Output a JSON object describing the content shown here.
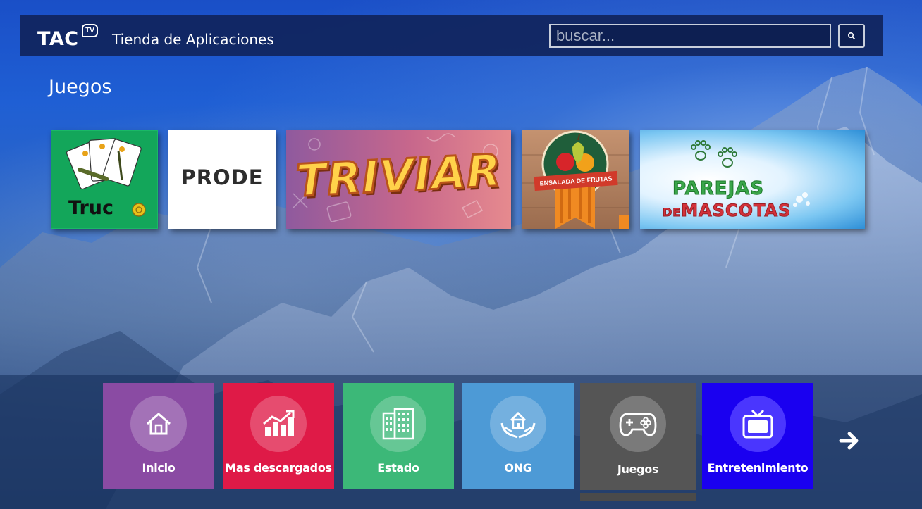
{
  "header": {
    "logo_text": "TAC",
    "logo_badge": "TV",
    "store_title": "Tienda de Aplicaciones",
    "search_placeholder": "buscar...",
    "search_icon": "search-icon"
  },
  "section_title": "Juegos",
  "apps": [
    {
      "name": "Truco",
      "label": "Truc",
      "icon": "playing-cards-icon"
    },
    {
      "name": "PRODE",
      "label": "PRODE"
    },
    {
      "name": "Triviar",
      "label": "TRIVIAR"
    },
    {
      "name": "Ensalada de Frutas",
      "label": "ENSALADA DE FRUTAS",
      "icon": "fruit-basket-icon"
    },
    {
      "name": "Parejas de Mascotas",
      "label_line1": "PAREJAS",
      "label_line2_small": "DE",
      "label_line2": "MASCOTAS",
      "icon": "paw-prints-icon"
    }
  ],
  "nav": [
    {
      "label": "Inicio",
      "icon": "home-icon",
      "color": "#8a4ba3"
    },
    {
      "label": "Mas descargados",
      "icon": "chart-up-icon",
      "color": "#df1a47"
    },
    {
      "label": "Estado",
      "icon": "building-icon",
      "color": "#3cb878"
    },
    {
      "label": "ONG",
      "icon": "hands-house-icon",
      "color": "#4d9ad6"
    },
    {
      "label": "Juegos",
      "icon": "gamepad-icon",
      "color": "#555555",
      "selected": true
    },
    {
      "label": "Entretenimiento",
      "icon": "tv-icon",
      "color": "#1a00f0"
    }
  ],
  "next_icon": "arrow-right-icon"
}
